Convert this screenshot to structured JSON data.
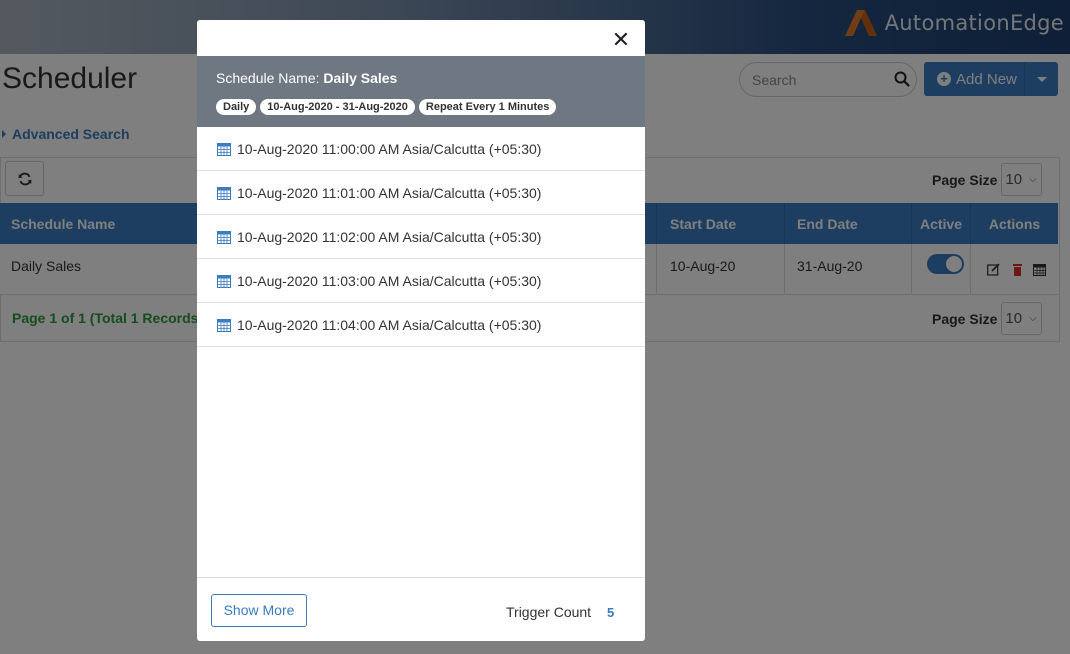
{
  "brand": {
    "name": "AutomationEdge"
  },
  "page": {
    "title": "Scheduler"
  },
  "search": {
    "placeholder": "Search"
  },
  "toolbar": {
    "add_new_label": "Add New",
    "advanced_search_label": "Advanced Search"
  },
  "page_size": {
    "label": "Page Size",
    "value": "10"
  },
  "table": {
    "headers": [
      "Schedule Name",
      "Start Date",
      "End Date",
      "Active",
      "Actions"
    ],
    "rows": [
      {
        "name": "Daily Sales",
        "start": "10-Aug-20",
        "end": "31-Aug-20",
        "active": true
      }
    ]
  },
  "pager": {
    "text": "Page 1 of 1 (Total 1 Records)"
  },
  "modal": {
    "schedule_label": "Schedule Name:",
    "schedule_name": "Daily Sales",
    "tags": [
      "Daily",
      "10-Aug-2020 - 31-Aug-2020",
      "Repeat Every 1 Minutes"
    ],
    "triggers": [
      "10-Aug-2020 11:00:00 AM Asia/Calcutta (+05:30)",
      "10-Aug-2020 11:01:00 AM Asia/Calcutta (+05:30)",
      "10-Aug-2020 11:02:00 AM Asia/Calcutta (+05:30)",
      "10-Aug-2020 11:03:00 AM Asia/Calcutta (+05:30)",
      "10-Aug-2020 11:04:00 AM Asia/Calcutta (+05:30)"
    ],
    "show_more_label": "Show More",
    "trigger_count_label": "Trigger Count",
    "trigger_count": "5"
  },
  "colors": {
    "primary": "#3a7cc0",
    "header_gray": "#6e7782",
    "success": "#2a9a3a"
  }
}
